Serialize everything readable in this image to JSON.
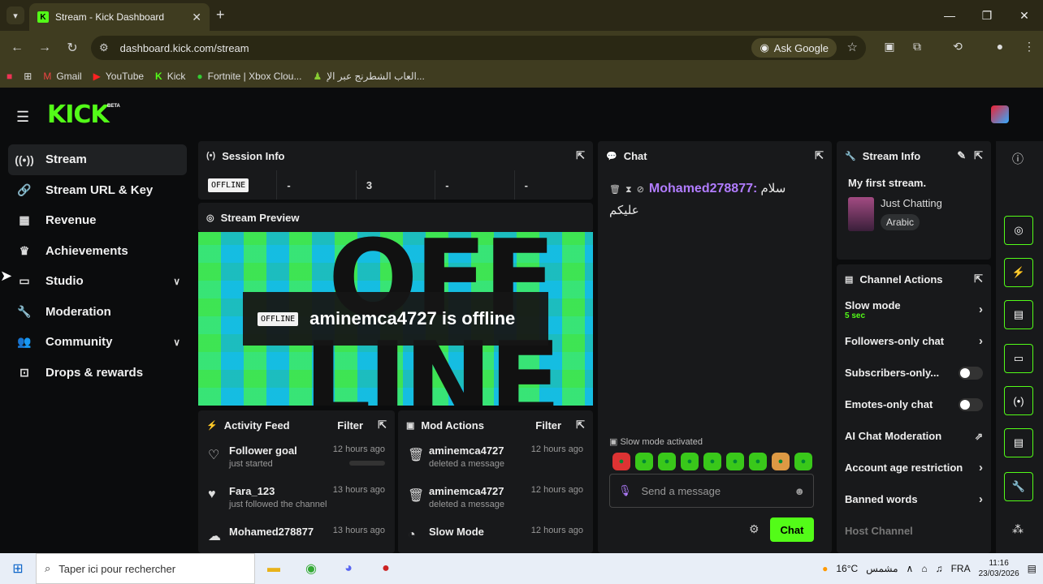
{
  "browser": {
    "tab_title": "Stream - Kick Dashboard",
    "url": "dashboard.kick.com/stream",
    "ask_google": "Ask Google",
    "bookmarks": [
      "Gmail",
      "YouTube",
      "Kick",
      "Fortnite | Xbox Clou...",
      "العاب الشطرنج عبر الإ..."
    ]
  },
  "app": {
    "logo": "KICK",
    "beta": "BETA"
  },
  "sidebar": {
    "items": [
      {
        "label": "Stream",
        "active": true,
        "icon": "broadcast-icon"
      },
      {
        "label": "Stream URL & Key",
        "icon": "link-icon"
      },
      {
        "label": "Revenue",
        "icon": "chart-icon"
      },
      {
        "label": "Achievements",
        "icon": "trophy-icon"
      },
      {
        "label": "Studio",
        "icon": "film-icon",
        "expandable": true
      },
      {
        "label": "Moderation",
        "icon": "wrench-icon"
      },
      {
        "label": "Community",
        "icon": "users-icon",
        "expandable": true
      },
      {
        "label": "Drops & rewards",
        "icon": "gift-icon"
      }
    ]
  },
  "session": {
    "title": "Session Info",
    "status": "OFFLINE",
    "cells": [
      "-",
      "3",
      "-",
      "-"
    ]
  },
  "preview": {
    "title": "Stream Preview",
    "badge": "OFFLINE",
    "message": "aminemca4727 is offline",
    "bg_word_1": "OFF",
    "bg_word_2": "LINE"
  },
  "activity": {
    "title": "Activity Feed",
    "filter": "Filter",
    "items": [
      {
        "title": "Follower goal",
        "sub": "just started",
        "time": "12 hours ago",
        "progress": 0
      },
      {
        "title": "Fara_123",
        "sub": "just followed the channel",
        "time": "13 hours ago"
      },
      {
        "title": "Mohamed278877",
        "sub": "",
        "time": "13 hours ago"
      }
    ]
  },
  "mod": {
    "title": "Mod Actions",
    "filter": "Filter",
    "items": [
      {
        "title": "aminemca4727",
        "sub": "deleted a message",
        "time": "12 hours ago"
      },
      {
        "title": "aminemca4727",
        "sub": "deleted a message",
        "time": "12 hours ago"
      },
      {
        "title": "Slow Mode",
        "sub": "",
        "time": "12 hours ago"
      }
    ]
  },
  "chat": {
    "title": "Chat",
    "user": "Mohamed278877:",
    "message": "سلام",
    "message2": "عليكم",
    "slow_mode": "Slow mode activated",
    "placeholder": "Send a message",
    "send": "Chat"
  },
  "stream_info": {
    "title": "Stream Info",
    "stream_title": "My first stream.",
    "category": "Just Chatting",
    "tag": "Arabic"
  },
  "channel_actions": {
    "title": "Channel Actions",
    "slow_mode": "Slow mode",
    "slow_value": "5 sec",
    "followers": "Followers-only chat",
    "subs": "Subscribers-only...",
    "emotes": "Emotes-only chat",
    "ai": "AI Chat Moderation",
    "age": "Account age restriction",
    "banned": "Banned words",
    "host": "Host Channel"
  },
  "taskbar": {
    "search": "Taper ici pour rechercher",
    "temp": "16°C",
    "weather": "مشمس",
    "lang": "FRA",
    "time": "11:16",
    "date": "23/03/2026"
  }
}
